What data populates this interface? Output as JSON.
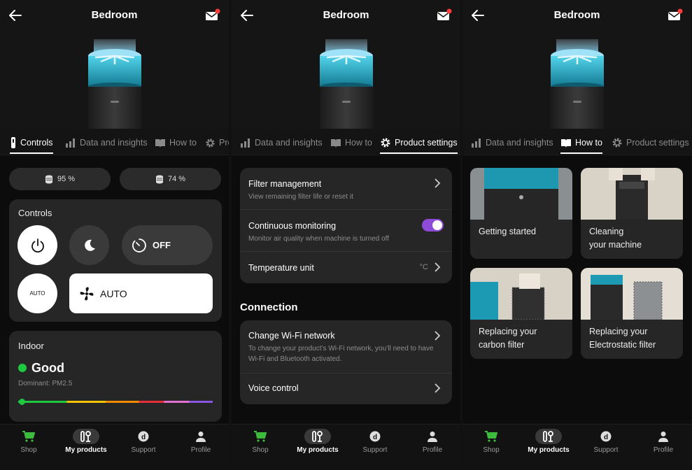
{
  "header": {
    "title": "Bedroom"
  },
  "tabs": {
    "controls": "Controls",
    "data": "Data and insights",
    "howto": "How to",
    "product": "Product settings",
    "product_clipped": "Prc"
  },
  "controls_screen": {
    "filters": [
      "95 %",
      "74 %"
    ],
    "controls_title": "Controls",
    "timer_label": "OFF",
    "auto_circle_label": "AUTO",
    "fan_label": "AUTO",
    "indoor": {
      "title": "Indoor",
      "status": "Good",
      "dominant": "Dominant: PM2.5",
      "status_color": "#1ec840"
    }
  },
  "settings_screen": {
    "rows": [
      {
        "title": "Filter management",
        "sub": "View remaining filter life or reset it"
      },
      {
        "title": "Continuous monitoring",
        "sub": "Monitor air quality when machine is turned off",
        "toggle": true
      },
      {
        "title": "Temperature unit",
        "value": "°C"
      }
    ],
    "connection_heading": "Connection",
    "connection_rows": [
      {
        "title": "Change Wi-Fi network",
        "sub": "To change your product’s Wi-Fi network, you’ll need to have Wi-Fi and Bluetooth activated."
      },
      {
        "title": "Voice control"
      }
    ]
  },
  "howto_screen": {
    "cards": [
      {
        "line1": "Getting started",
        "line2": ""
      },
      {
        "line1": "Cleaning",
        "line2": "your machine"
      },
      {
        "line1": "Replacing your",
        "line2": "carbon filter"
      },
      {
        "line1": "Replacing your",
        "line2": "Electrostatic filter"
      }
    ]
  },
  "nav": {
    "shop": "Shop",
    "products": "My products",
    "support": "Support",
    "profile": "Profile"
  },
  "colors": {
    "accent_purple": "#8e4bd8",
    "device_cyan": "#2fb7d4",
    "shop_green": "#3dbb3d",
    "notification_red": "#ff3b3b"
  }
}
